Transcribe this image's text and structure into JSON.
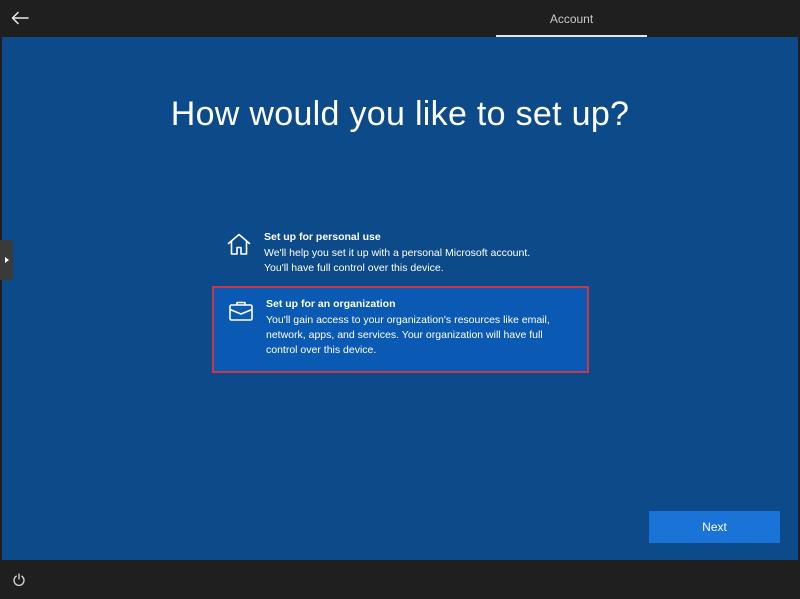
{
  "header": {
    "back_icon": "arrow-left-icon",
    "tab_label": "Account"
  },
  "main": {
    "title": "How would you like to set up?",
    "options": [
      {
        "icon": "home-icon",
        "title": "Set up for personal use",
        "description": "We'll help you set it up with a personal Microsoft account.\nYou'll have full control over this device.",
        "selected": false
      },
      {
        "icon": "briefcase-icon",
        "title": "Set up for an organization",
        "description": "You'll gain access to your organization's resources like email,\nnetwork, apps, and services. Your organization will have full\ncontrol over this device.",
        "selected": true
      }
    ],
    "next_label": "Next"
  },
  "footer": {
    "accessibility_icon": "power-ease-of-access-icon"
  },
  "colors": {
    "background": "#0c4a8a",
    "selected_option": "#0a5ab4",
    "selection_outline": "#c8374a",
    "primary_button": "#1a73d6",
    "chrome": "#1f1f1f"
  }
}
